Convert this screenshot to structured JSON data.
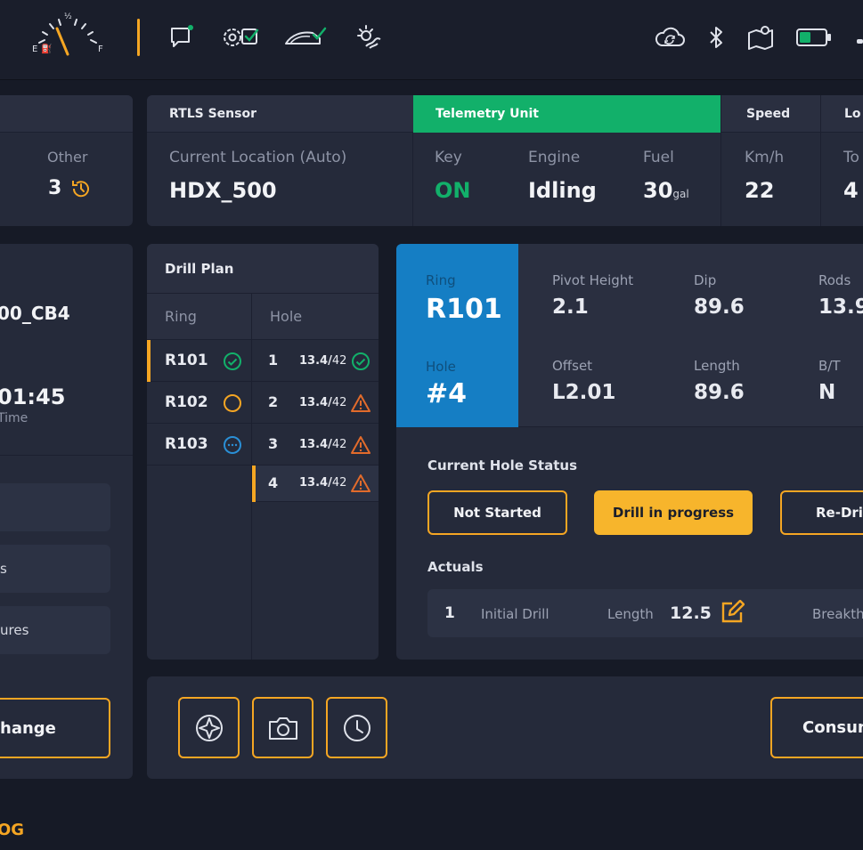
{
  "colors": {
    "accent": "#f5a623",
    "success": "#12b06a",
    "info": "#157ec4",
    "warning": "#e26b2b"
  },
  "topbar": {
    "fuel_gauge": {
      "empty_label": "E",
      "half_label": "½",
      "full_label": "F"
    },
    "icons": [
      "fuel-gauge-icon",
      "message-icon",
      "settings-check-icon",
      "vehicle-check-icon",
      "weather-icon",
      "cloud-sync-icon",
      "bluetooth-icon",
      "map-icon",
      "battery-icon"
    ]
  },
  "left_panel": {
    "other_label": "Other",
    "other_value": "3",
    "id_fragment": "00_CB4",
    "time_fragment": "01:45",
    "time_label_fragment": "Time",
    "menu_items": [
      "s",
      "ures"
    ],
    "change_button": "hange"
  },
  "status_bar": {
    "rtls": {
      "header": "RTLS Sensor",
      "label": "Current Location (Auto)",
      "value": "HDX_500"
    },
    "telemetry": {
      "header": "Telemetry Unit",
      "key_label": "Key",
      "key_value": "ON",
      "engine_label": "Engine",
      "engine_value": "Idling",
      "fuel_label": "Fuel",
      "fuel_value": "30",
      "fuel_unit": "gal"
    },
    "speed": {
      "header": "Speed",
      "label": "Km/h",
      "value": "22"
    },
    "loc": {
      "header": "Lo",
      "label": "To",
      "value": "4"
    }
  },
  "drill_plan": {
    "title": "Drill Plan",
    "ring_header": "Ring",
    "hole_header": "Hole",
    "rings": [
      {
        "name": "R101",
        "status": "complete"
      },
      {
        "name": "R102",
        "status": "pending"
      },
      {
        "name": "R103",
        "status": "in-progress"
      }
    ],
    "holes": [
      {
        "num": "1",
        "length": "13.4",
        "total": "42",
        "status": "complete"
      },
      {
        "num": "2",
        "length": "13.4",
        "total": "42",
        "status": "warning"
      },
      {
        "num": "3",
        "length": "13.4",
        "total": "42",
        "status": "warning"
      },
      {
        "num": "4",
        "length": "13.4",
        "total": "42",
        "status": "warning"
      }
    ]
  },
  "hole_detail": {
    "ring_label": "Ring",
    "ring_value": "R101",
    "hole_label": "Hole",
    "hole_value": "#4",
    "pivot_label": "Pivot Height",
    "pivot_value": "2.1",
    "dip_label": "Dip",
    "dip_value": "89.6",
    "rods_label": "Rods",
    "rods_value": "13.9",
    "offset_label": "Offset",
    "offset_value": "L2.01",
    "length_label": "Length",
    "length_value": "89.6",
    "bt_label": "B/T",
    "bt_value": "N",
    "status_title": "Current Hole Status",
    "status_buttons": [
      "Not Started",
      "Drill in progress",
      "Re-Dri"
    ],
    "actuals_title": "Actuals",
    "actual_row": {
      "num": "1",
      "name": "Initial Drill",
      "length_label": "Length",
      "length_value": "12.5",
      "breakthrough_label": "Breakth"
    }
  },
  "bottom_toolbar": {
    "consume_button": "Consun"
  },
  "footer": {
    "fragment": "OG"
  }
}
